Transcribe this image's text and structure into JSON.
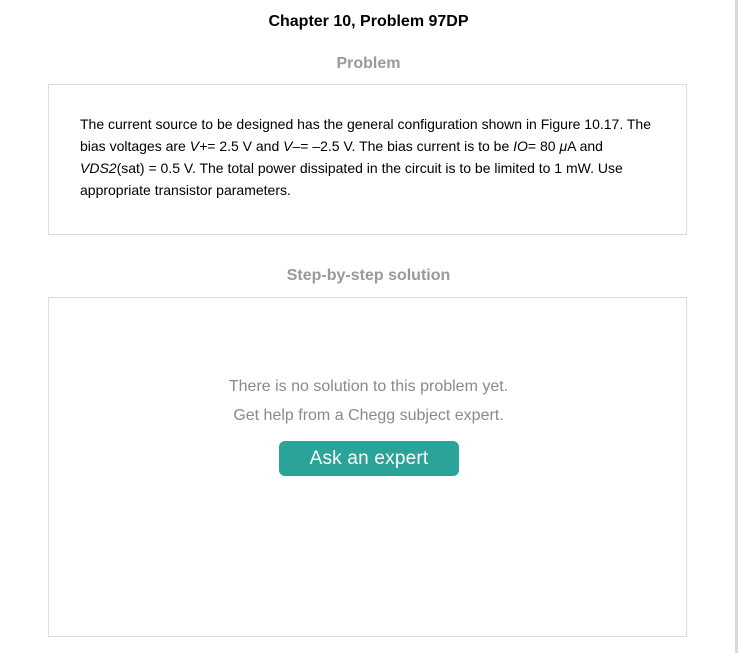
{
  "header": {
    "title": "Chapter 10, Problem 97DP"
  },
  "problem": {
    "heading": "Problem",
    "seg1": "The current source to be designed has the general configuration shown in Figure 10.17. The bias voltages are ",
    "v_plus": "V+",
    "seg2": "= 2.5 V and ",
    "v_minus": "V–",
    "seg3": "= –2.5 V. The bias current is to be ",
    "io": "IO",
    "seg4": "= 80 ",
    "mu": "μ",
    "seg5": "A and ",
    "vds2": "VDS2",
    "seg6": "(sat) = 0.5 V. The total power dissipated in the circuit is to be limited to 1 mW. Use appropriate transistor parameters."
  },
  "solution": {
    "heading": "Step-by-step solution",
    "line1": "There is no solution to this problem yet.",
    "line2": "Get help from a Chegg subject expert.",
    "button_label": "Ask an expert"
  },
  "colors": {
    "accent": "#2aa398",
    "heading_gray": "#999999",
    "border": "#dcdcdc"
  }
}
